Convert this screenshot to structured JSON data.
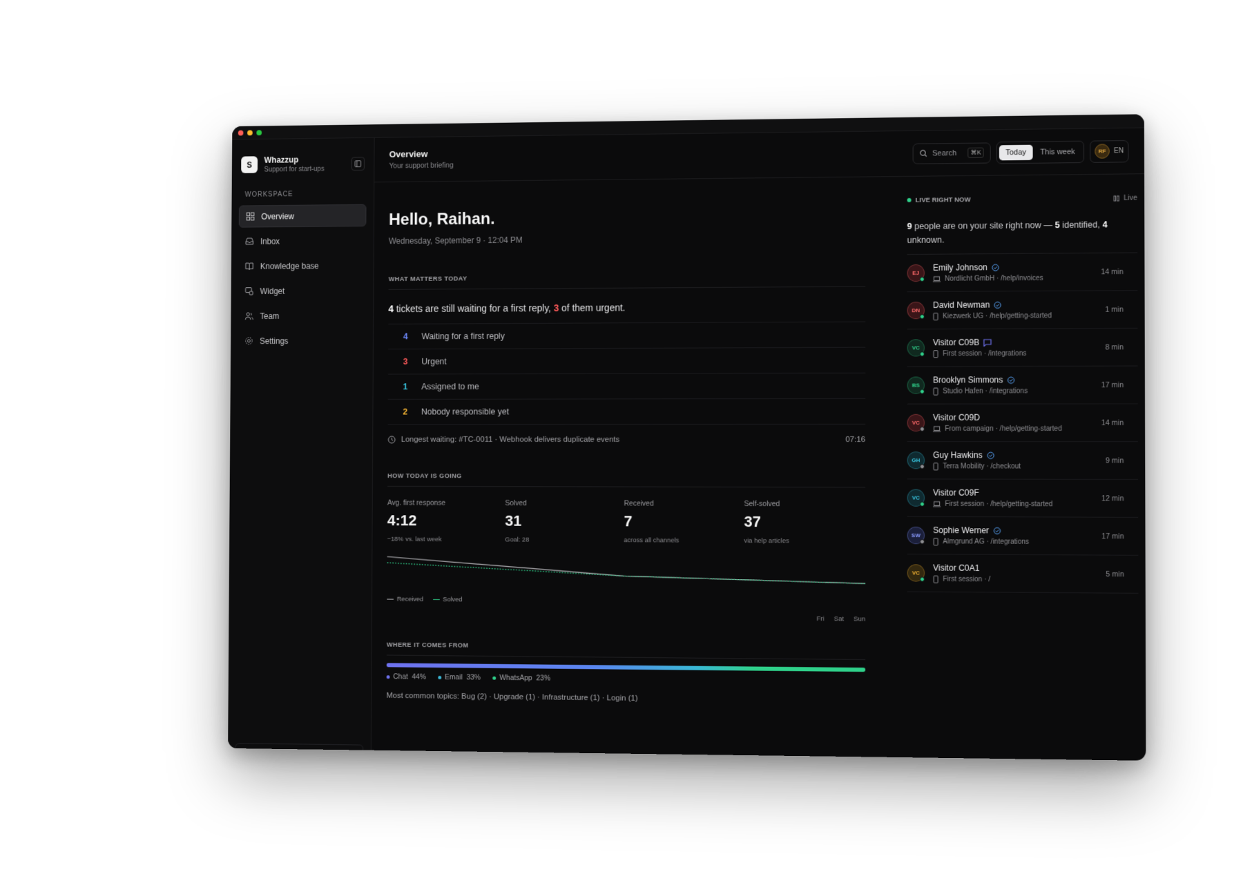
{
  "app": {
    "name": "Whazzup",
    "tagline": "Support for start-ups",
    "logo_letter": "S",
    "accent": "#2fd08a"
  },
  "sidebar": {
    "section": "WORKSPACE",
    "items": [
      {
        "label": "Overview",
        "icon": "grid-icon",
        "active": true
      },
      {
        "label": "Inbox",
        "icon": "inbox-icon"
      },
      {
        "label": "Knowledge base",
        "icon": "book-icon"
      },
      {
        "label": "Widget",
        "icon": "widget-icon"
      },
      {
        "label": "Team",
        "icon": "users-icon"
      },
      {
        "label": "Settings",
        "icon": "gear-icon"
      }
    ]
  },
  "header": {
    "title": "Overview",
    "subtitle": "Your support briefing",
    "search_label": "Search",
    "search_shortcut": "⌘K",
    "ranges": [
      "Today",
      "This week"
    ],
    "user_initials": "RF",
    "language": "EN"
  },
  "greeting": {
    "hello": "Hello, Raihan.",
    "date": "Wednesday, September 9 · 12:04 PM"
  },
  "matters": {
    "title": "WHAT MATTERS TODAY",
    "headline_count": "4",
    "headline_mid": " tickets are still waiting for a first reply, ",
    "headline_urgent": "3",
    "headline_end": " of them urgent.",
    "rows": [
      {
        "num": "4",
        "label": "Waiting for a first reply",
        "color": "#6f8bff"
      },
      {
        "num": "3",
        "label": "Urgent",
        "color": "#ff5a5a"
      },
      {
        "num": "1",
        "label": "Assigned to me",
        "color": "#38c6e0"
      },
      {
        "num": "2",
        "label": "Nobody responsible yet",
        "color": "#f2b233"
      }
    ],
    "longest": "Longest waiting: #TC-0011 · Webhook delivers duplicate events",
    "longest_time": "07:16"
  },
  "going": {
    "title": "HOW TODAY IS GOING",
    "stats": [
      {
        "label": "Avg. first response",
        "value": "4:12",
        "sub": "−18% vs. last week"
      },
      {
        "label": "Solved",
        "value": "31",
        "sub": "Goal: 28"
      },
      {
        "label": "Received",
        "value": "7",
        "sub": "across all channels"
      },
      {
        "label": "Self-solved",
        "value": "37",
        "sub": "via help articles"
      }
    ],
    "legend": [
      "Received",
      "Solved"
    ],
    "days": [
      "Fri",
      "Sat",
      "Sun"
    ]
  },
  "chart_data": {
    "type": "line",
    "x": [
      "Fri",
      "Sat",
      "Sun"
    ],
    "series": [
      {
        "name": "Received",
        "values": [
          10,
          4,
          2
        ],
        "color": "#bdbdc1"
      },
      {
        "name": "Solved",
        "values": [
          8,
          4,
          2
        ],
        "color": "#2fd08a"
      }
    ]
  },
  "from": {
    "title": "WHERE IT COMES FROM",
    "channels": [
      {
        "name": "Chat",
        "pct": "44%",
        "color": "#6f72f0"
      },
      {
        "name": "Email",
        "pct": "33%",
        "color": "#3ab8d6"
      },
      {
        "name": "WhatsApp",
        "pct": "23%",
        "color": "#2fd08a"
      }
    ],
    "topics": "Most common topics: Bug (2) · Upgrade (1) · Infrastructure (1) · Login (1)"
  },
  "live": {
    "title": "LIVE RIGHT NOW",
    "toggle": "Live",
    "people": "9",
    "summary_mid": " people are on your site right now — ",
    "identified": "5",
    "summary_mid2": " identified, ",
    "unknown": "4",
    "summary_end": " unknown.",
    "visitors": [
      {
        "initials": "EJ",
        "name": "Emily Johnson",
        "badge": "verified",
        "device": "laptop",
        "meta": "Nordlicht GmbH · /help/invoices",
        "time": "14 min",
        "bg": "#3a1518",
        "fg": "#ff6b6b",
        "status": "#2fd08a"
      },
      {
        "initials": "DN",
        "name": "David Newman",
        "badge": "verified",
        "device": "phone",
        "meta": "Kiezwerk UG · /help/getting-started",
        "time": "1 min",
        "bg": "#3a1518",
        "fg": "#ff6b6b",
        "status": "#2fd08a"
      },
      {
        "initials": "VC",
        "name": "Visitor C09B",
        "badge": "chat",
        "device": "phone",
        "meta": "First session · /integrations",
        "time": "8 min",
        "bg": "#10291f",
        "fg": "#2fd08a",
        "status": "#2fd08a"
      },
      {
        "initials": "BS",
        "name": "Brooklyn Simmons",
        "badge": "verified",
        "device": "phone",
        "meta": "Studio Hafen · /integrations",
        "time": "17 min",
        "bg": "#10291f",
        "fg": "#2fd08a",
        "status": "#2fd08a"
      },
      {
        "initials": "VC",
        "name": "Visitor C09D",
        "badge": "",
        "device": "laptop",
        "meta": "From campaign · /help/getting-started",
        "time": "14 min",
        "bg": "#3a1518",
        "fg": "#ff6b6b",
        "status": "#8e8e92"
      },
      {
        "initials": "GH",
        "name": "Guy Hawkins",
        "badge": "verified",
        "device": "phone",
        "meta": "Terra Mobility · /checkout",
        "time": "9 min",
        "bg": "#0f2a30",
        "fg": "#38c6e0",
        "status": "#8e8e92"
      },
      {
        "initials": "VC",
        "name": "Visitor C09F",
        "badge": "",
        "device": "laptop",
        "meta": "First session · /help/getting-started",
        "time": "12 min",
        "bg": "#0f2a30",
        "fg": "#38c6e0",
        "status": "#2fd08a"
      },
      {
        "initials": "SW",
        "name": "Sophie Werner",
        "badge": "verified",
        "device": "phone",
        "meta": "Almgrund AG · /integrations",
        "time": "17 min",
        "bg": "#1b1f3a",
        "fg": "#8a9bff",
        "status": "#8e8e92"
      },
      {
        "initials": "VC",
        "name": "Visitor C0A1",
        "badge": "",
        "device": "phone",
        "meta": "First session · /",
        "time": "5 min",
        "bg": "#33280f",
        "fg": "#f2b233",
        "status": "#2fd08a"
      }
    ]
  }
}
